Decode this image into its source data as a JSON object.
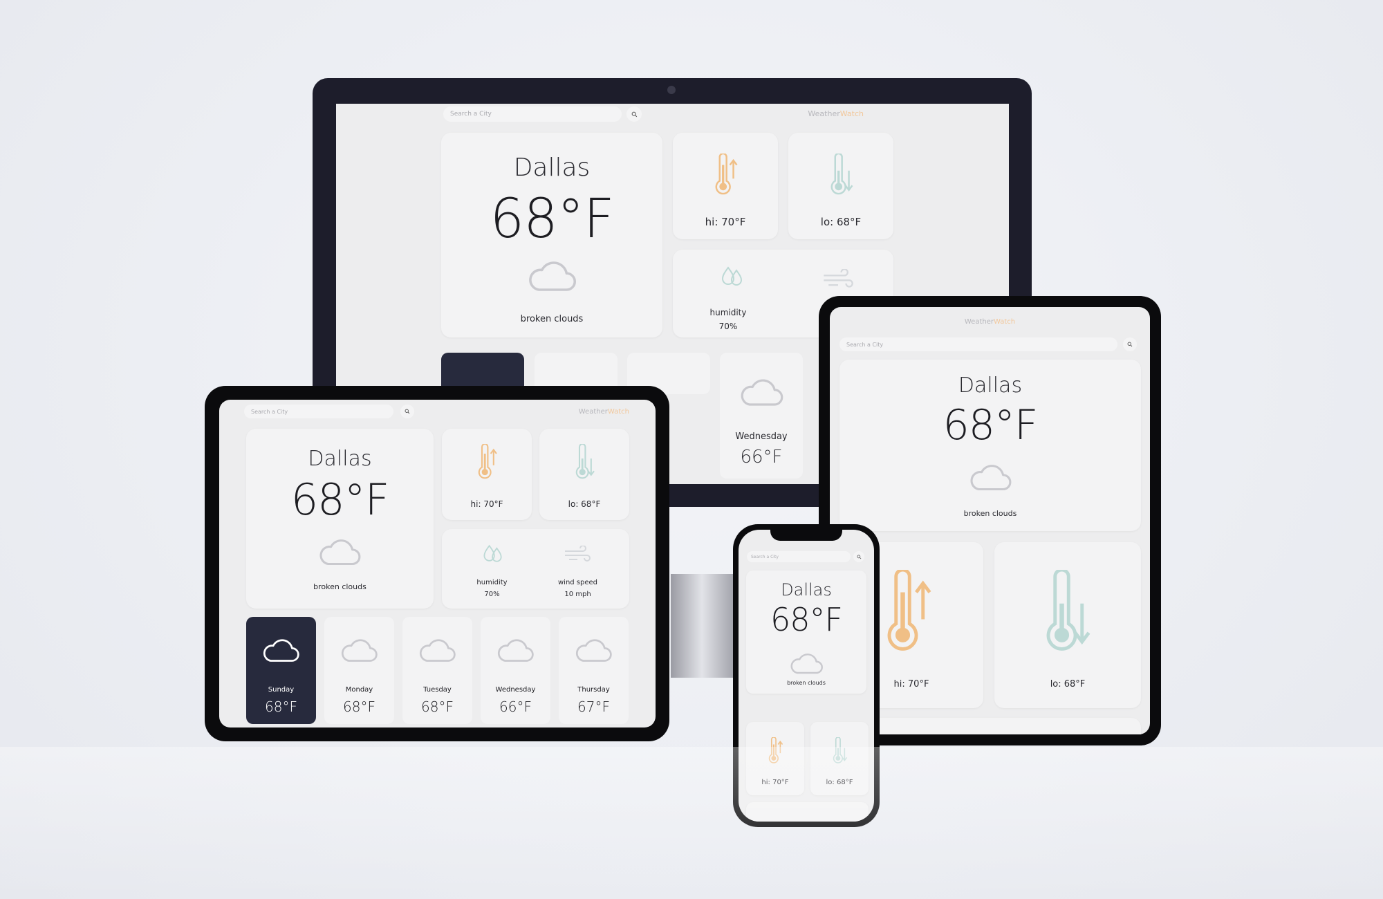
{
  "app": {
    "brand_part1": "Weather",
    "brand_part2": "Watch",
    "search_placeholder": "Search a City"
  },
  "current": {
    "city": "Dallas",
    "temp": "68°F",
    "description": "broken clouds",
    "hi": "hi: 70°F",
    "lo": "lo: 68°F",
    "humidity_label": "humidity",
    "humidity_value": "70%",
    "wind_label": "wind speed",
    "wind_value": "10 mph"
  },
  "forecast": [
    {
      "day": "Sunday",
      "temp": "68°F",
      "active": true
    },
    {
      "day": "Monday",
      "temp": "68°F"
    },
    {
      "day": "Tuesday",
      "temp": "68°F"
    },
    {
      "day": "Wednesday",
      "temp": "66°F"
    },
    {
      "day": "Thursday",
      "temp": "67°F"
    }
  ],
  "colors": {
    "background": "#eceef3",
    "device_frame": "#0b0b0d",
    "monitor_frame": "#1d1d2b",
    "ui_background": "#ededee",
    "card": "#f3f3f4",
    "active_day": "#272a3d",
    "hi_accent": "#f0bf86",
    "lo_accent": "#bcd9d5",
    "brand_accent": "#f2c79a"
  },
  "icons": [
    "search-icon",
    "cloud-icon",
    "thermometer-up-icon",
    "thermometer-down-icon",
    "droplets-icon",
    "wind-icon"
  ]
}
